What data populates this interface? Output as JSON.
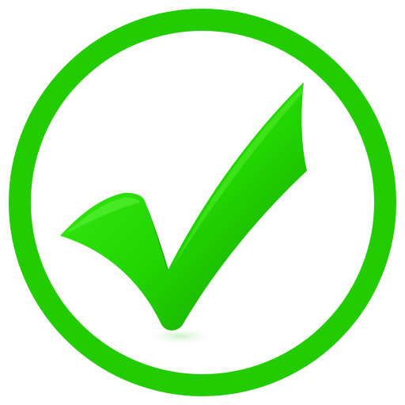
{
  "icon": {
    "name": "check-mark-in-circle",
    "colors": {
      "ring": "#22cc00",
      "check_light": "#3ff21a",
      "check_mid": "#22d400",
      "check_dark": "#139e00",
      "background": "#ffffff"
    }
  }
}
